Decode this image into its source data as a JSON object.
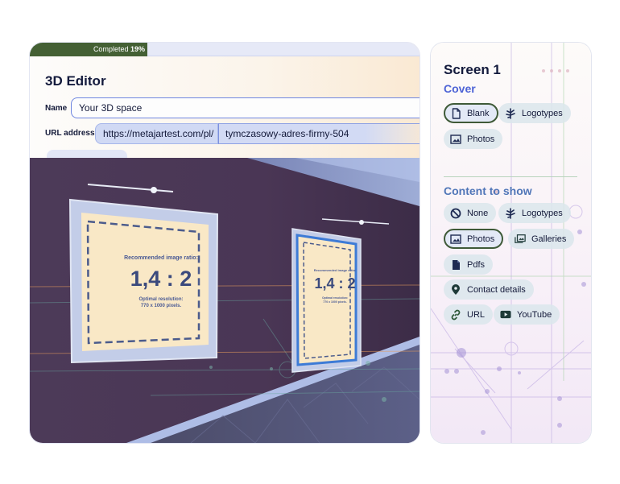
{
  "editor": {
    "progress": {
      "label": "Completed",
      "value_text": "19%",
      "fraction": 0.19
    },
    "title": "3D Editor",
    "name_field": {
      "label": "Name",
      "value": "Your 3D space"
    },
    "url_field": {
      "label": "URL address",
      "prefix": "https://metajartest.com/pl/",
      "value": "tymczasowy-adres-firmy-504"
    },
    "scene": {
      "frame_large": {
        "ratio_caption": "Recommended image ratio:",
        "ratio_value": "1,4 : 2",
        "resolution_caption": "Optimal resolution:",
        "resolution_value": "770 x 1000 pixels."
      },
      "frame_small": {
        "ratio_caption": "Recommended image ratio:",
        "ratio_value": "1,4 : 2",
        "resolution_caption": "Optimal resolution:",
        "resolution_value": "770 x 1000 pixels."
      }
    }
  },
  "panel": {
    "screen_title": "Screen 1",
    "cover": {
      "title": "Cover",
      "options": [
        {
          "label": "Blank",
          "icon": "file-icon",
          "selected": true
        },
        {
          "label": "Logotypes",
          "icon": "logotypes-icon",
          "selected": false
        },
        {
          "label": "Photos",
          "icon": "image-icon",
          "selected": false
        }
      ]
    },
    "content": {
      "title": "Content to show",
      "options": [
        {
          "label": "None",
          "icon": "ban-icon",
          "selected": false
        },
        {
          "label": "Logotypes",
          "icon": "logotypes-icon",
          "selected": false
        },
        {
          "label": "Photos",
          "icon": "image-icon",
          "selected": true
        },
        {
          "label": "Galleries",
          "icon": "gallery-icon",
          "selected": false
        },
        {
          "label": "Pdfs",
          "icon": "pdf-icon",
          "selected": false
        },
        {
          "label": "Contact details",
          "icon": "map-pin-icon",
          "selected": false
        },
        {
          "label": "URL",
          "icon": "link-icon",
          "selected": false
        },
        {
          "label": "YouTube",
          "icon": "youtube-icon",
          "selected": false
        }
      ]
    },
    "colors": {
      "accent_green": "#446034",
      "cover_blue": "#4d63d6",
      "content_blue": "#5076b8"
    }
  }
}
